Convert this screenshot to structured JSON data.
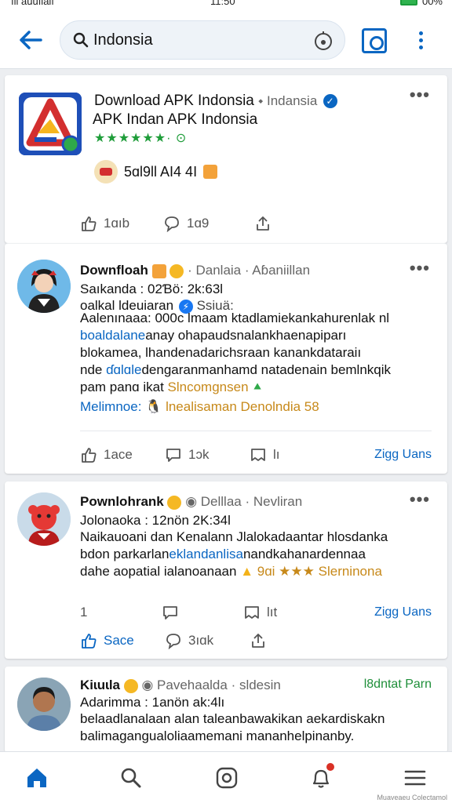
{
  "status_bar": {
    "left": "ıll auuılalı",
    "time": "11:50",
    "right": "00%"
  },
  "top_bar": {
    "search_value": "Indonsia"
  },
  "app_card": {
    "title": "Download APK Indonsia",
    "source": "Indansia",
    "subtitle": "APK Indan APK Indonsia",
    "rating_text": "★★★★★★· ⊙",
    "chip_text": "5ɑl9ll AI4 4I",
    "likes": "1ɑıb",
    "comments": "1ɑ9",
    "menu": "•••"
  },
  "post1": {
    "name": "Downfloah",
    "meta": "Danlaia · Aɓaniillan",
    "line1": "Saıkanda : 02Ɓö: 2k:63l",
    "line2": "oalkal ldeuiaran",
    "line2_tail": "Ssiuä:",
    "body": [
      "Aalenınaaa: 000c lmaam ktadlamiekankahurenlak nl",
      "boaldalaneanay ohapaudsnalankhaenapiparı",
      "blokamea, lhandenadarichsraan kanankdataraiı",
      "nde ɗɑlɑldengaranmanhamd natadenain bemlnkqik",
      "pam panɑ ikat"
    ],
    "body_hl_word1": "boaldalane",
    "body_hl_word2": "ɗɑlɑle",
    "body_gold": "Slncomgnsen",
    "footer_link": "Melimnoe:",
    "footer_gold": "lnealisaman Denolndia 58",
    "act_like": "1ace",
    "act_comment": "1ɔk",
    "act_share": "lı",
    "follow": "Ziɡg Uans",
    "menu": "•••"
  },
  "post2": {
    "name": "Pownlohrank",
    "meta": "Delllaa · Nevliran",
    "line1": "Jolonaoka : 12nön 2K:34l",
    "body": [
      "Naikauoani dan Kenalann Jlalokadaantar hlosdanka",
      "bdon parkarlaneklandanlisanandkahanardennaa",
      "dahe aopatial ialanoanaan"
    ],
    "body_hl": "eklandanlisa",
    "body_gold": "9ɑi ★★★ Slerninona",
    "act_count": "1",
    "act_share": "lıt",
    "follow": "Ziɡg Uans",
    "act_save": "Sace",
    "act_comment": "3ıɑk",
    "menu": "•••"
  },
  "post3": {
    "name": "Kiɩuɩla",
    "meta": "Pavehaalda · sldesin",
    "line1": "Adarimma : 1anön ak:4lı",
    "body": [
      "belaadlanalaan alan taleanbawakikan aekardiskakn",
      "balimagangualoliaamemani mananhelpinanby."
    ],
    "follow": "l8dntat Parn"
  },
  "bottom_nav": {
    "watermark": "Muaveaeu Colectamol"
  },
  "colors": {
    "accent": "#0a66c2",
    "green": "#1f9d3a",
    "gold": "#c7891a",
    "badge": "#d93025"
  }
}
